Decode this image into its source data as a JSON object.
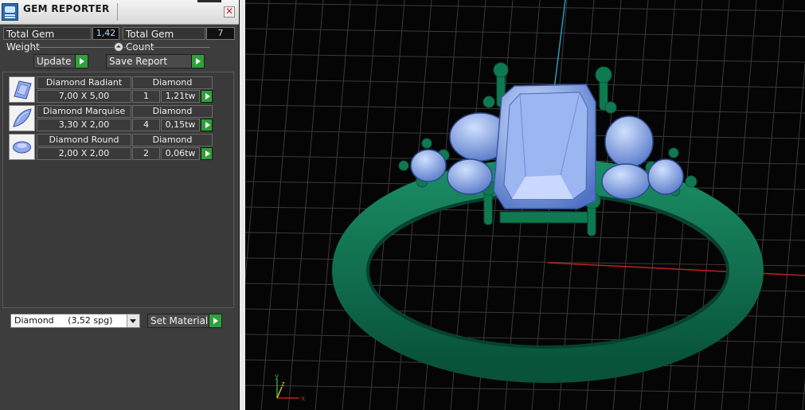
{
  "window": {
    "title": "GEM REPORTER"
  },
  "stats": {
    "total_weight_label": "Total Gem Weight",
    "total_weight_value": "1,42",
    "total_count_label": "Total Gem Count",
    "total_count_value": "7"
  },
  "actions": {
    "update_label": "Update",
    "save_report_label": "Save Report"
  },
  "gems": [
    {
      "name": "Diamond Radiant",
      "material": "Diamond",
      "size": "7,00 X 5,00",
      "count": "1",
      "weight": "1,21tw",
      "icon": "radiant-cut-icon"
    },
    {
      "name": "Diamond Marquise",
      "material": "Diamond",
      "size": "3,30 X 2,00",
      "count": "4",
      "weight": "0,15tw",
      "icon": "marquise-cut-icon"
    },
    {
      "name": "Diamond Round",
      "material": "Diamond",
      "size": "2,00 X 2,00",
      "count": "2",
      "weight": "0,06tw",
      "icon": "round-cut-icon"
    }
  ],
  "material": {
    "selected": "Diamond     (3,52 spg)",
    "set_label": "Set Material"
  },
  "viewport": {
    "axis_x_label": "x",
    "axis_y_label": "y",
    "axis_z_label": "z",
    "colors": {
      "metal": "#0e6b4a",
      "gem": "#7fa6e8",
      "grid": "#3a3a3a",
      "x_axis": "#c02020",
      "y_axis": "#1fa0c0"
    }
  }
}
